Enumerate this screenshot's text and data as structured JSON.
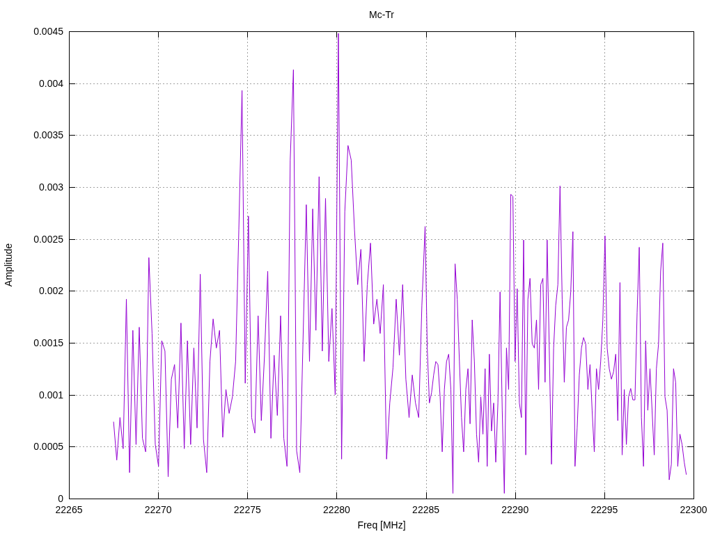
{
  "chart": {
    "chart_data": {
      "type": "line",
      "title": "Mc-Tr",
      "xlabel": "Freq [MHz]",
      "ylabel": "Amplitude",
      "xlim": [
        22265,
        22300
      ],
      "ylim": [
        0,
        0.0045
      ],
      "xticks": [
        22265,
        22270,
        22275,
        22280,
        22285,
        22290,
        22295,
        22300
      ],
      "yticks": [
        0,
        0.0005,
        0.001,
        0.0015,
        0.002,
        0.0025,
        0.003,
        0.0035,
        0.004,
        0.0045
      ],
      "x": [
        22267.5,
        22267.68,
        22267.86,
        22268.04,
        22268.22,
        22268.4,
        22268.58,
        22268.76,
        22268.94,
        22269.12,
        22269.3,
        22269.48,
        22269.66,
        22269.84,
        22270.02,
        22270.2,
        22270.38,
        22270.56,
        22270.74,
        22270.92,
        22271.1,
        22271.28,
        22271.46,
        22271.64,
        22271.82,
        22272.0,
        22272.18,
        22272.36,
        22272.54,
        22272.72,
        22272.9,
        22273.08,
        22273.26,
        22273.44,
        22273.62,
        22273.8,
        22273.98,
        22274.16,
        22274.34,
        22274.52,
        22274.7,
        22274.88,
        22275.06,
        22275.24,
        22275.42,
        22275.6,
        22275.78,
        22275.96,
        22276.14,
        22276.32,
        22276.5,
        22276.68,
        22276.86,
        22277.04,
        22277.22,
        22277.4,
        22277.58,
        22277.76,
        22277.94,
        22278.12,
        22278.3,
        22278.48,
        22278.66,
        22278.84,
        22279.02,
        22279.2,
        22279.38,
        22279.56,
        22279.74,
        22279.92,
        22280.1,
        22280.28,
        22280.46,
        22280.64,
        22280.82,
        22281.0,
        22281.18,
        22281.36,
        22281.54,
        22281.72,
        22281.9,
        22282.08,
        22282.26,
        22282.44,
        22282.62,
        22282.8,
        22282.98,
        22283.16,
        22283.34,
        22283.52,
        22283.7,
        22283.88,
        22284.06,
        22284.24,
        22284.42,
        22284.6,
        22284.78,
        22284.96,
        22285.08,
        22285.2,
        22285.32,
        22285.44,
        22285.56,
        22285.68,
        22285.8,
        22285.92,
        22286.04,
        22286.16,
        22286.28,
        22286.4,
        22286.52,
        22286.64,
        22286.76,
        22286.88,
        22287.0,
        22287.12,
        22287.24,
        22287.36,
        22287.48,
        22287.6,
        22287.72,
        22287.84,
        22287.96,
        22288.08,
        22288.2,
        22288.32,
        22288.44,
        22288.56,
        22288.68,
        22288.8,
        22288.92,
        22289.04,
        22289.16,
        22289.28,
        22289.4,
        22289.52,
        22289.64,
        22289.76,
        22289.88,
        22290.0,
        22290.12,
        22290.24,
        22290.36,
        22290.48,
        22290.6,
        22290.72,
        22290.84,
        22290.96,
        22291.08,
        22291.2,
        22291.32,
        22291.44,
        22291.56,
        22291.68,
        22291.8,
        22291.92,
        22292.04,
        22292.16,
        22292.28,
        22292.4,
        22292.52,
        22292.64,
        22292.76,
        22292.88,
        22293.0,
        22293.12,
        22293.24,
        22293.36,
        22293.48,
        22293.6,
        22293.72,
        22293.84,
        22293.96,
        22294.08,
        22294.2,
        22294.32,
        22294.44,
        22294.56,
        22294.68,
        22294.8,
        22294.92,
        22295.04,
        22295.16,
        22295.28,
        22295.4,
        22295.52,
        22295.64,
        22295.76,
        22295.88,
        22296.0,
        22296.12,
        22296.24,
        22296.36,
        22296.48,
        22296.6,
        22296.72,
        22296.84,
        22296.96,
        22297.08,
        22297.2,
        22297.32,
        22297.44,
        22297.56,
        22297.68,
        22297.8,
        22297.92,
        22298.04,
        22298.16,
        22298.28,
        22298.4,
        22298.52,
        22298.64,
        22298.76,
        22298.88,
        22299.0,
        22299.12,
        22299.24,
        22299.36,
        22299.48,
        22299.6
      ],
      "grid": true,
      "series": [
        {
          "color": "#9400d3",
          "values": [
            0.00074,
            0.00037,
            0.00078,
            0.00048,
            0.00192,
            0.00025,
            0.00162,
            0.00052,
            0.00165,
            0.00058,
            0.00045,
            0.00232,
            0.00159,
            0.00052,
            0.00031,
            0.00152,
            0.00142,
            0.00021,
            0.00115,
            0.00129,
            0.00068,
            0.00169,
            0.00048,
            0.00152,
            0.00052,
            0.00145,
            0.00068,
            0.00216,
            0.00057,
            0.00025,
            0.00132,
            0.00173,
            0.00145,
            0.00162,
            0.00059,
            0.00105,
            0.00082,
            0.00098,
            0.00132,
            0.00259,
            0.00393,
            0.00111,
            0.00272,
            0.00078,
            0.00063,
            0.00176,
            0.00075,
            0.00138,
            0.00219,
            0.00058,
            0.00138,
            0.0008,
            0.00176,
            0.00058,
            0.00031,
            0.00326,
            0.00413,
            0.00046,
            0.00025,
            0.00152,
            0.00283,
            0.00132,
            0.00279,
            0.00162,
            0.0031,
            0.00142,
            0.00289,
            0.00132,
            0.00183,
            0.001,
            0.00448,
            0.00038,
            0.00276,
            0.0034,
            0.00326,
            0.00259,
            0.00206,
            0.0024,
            0.00132,
            0.00206,
            0.00246,
            0.00168,
            0.00192,
            0.00159,
            0.00206,
            0.00038,
            0.00092,
            0.00126,
            0.00192,
            0.00138,
            0.00206,
            0.00115,
            0.00078,
            0.00119,
            0.00092,
            0.00078,
            0.00186,
            0.00262,
            0.00145,
            0.00092,
            0.00102,
            0.00119,
            0.00132,
            0.00129,
            0.00098,
            0.00045,
            0.00105,
            0.00132,
            0.00139,
            0.00105,
            5e-05,
            0.00226,
            0.00192,
            0.00132,
            0.00078,
            0.00045,
            0.00105,
            0.00125,
            0.00072,
            0.00172,
            0.00132,
            0.00062,
            0.00035,
            0.00098,
            0.00062,
            0.00125,
            0.00031,
            0.00139,
            0.00065,
            0.00092,
            0.00035,
            0.00092,
            0.00199,
            0.00085,
            5e-05,
            0.00145,
            0.00105,
            0.00293,
            0.00291,
            0.00132,
            0.00202,
            0.00092,
            0.00078,
            0.00249,
            0.00042,
            0.00192,
            0.00212,
            0.00149,
            0.00145,
            0.00172,
            0.00105,
            0.00206,
            0.00212,
            0.00112,
            0.00249,
            0.00142,
            0.00033,
            0.00145,
            0.00186,
            0.00206,
            0.00301,
            0.00192,
            0.00112,
            0.00165,
            0.00172,
            0.00199,
            0.00257,
            0.00031,
            0.00068,
            0.00119,
            0.00145,
            0.00155,
            0.00149,
            0.00105,
            0.00129,
            0.00085,
            0.00045,
            0.00125,
            0.00105,
            0.00132,
            0.00172,
            0.00253,
            0.00145,
            0.00125,
            0.00115,
            0.00122,
            0.00139,
            0.00075,
            0.00208,
            0.00042,
            0.00105,
            0.00052,
            0.00098,
            0.00106,
            0.00095,
            0.00095,
            0.00179,
            0.00242,
            0.00078,
            0.00031,
            0.00152,
            0.00085,
            0.00125,
            0.00085,
            0.00042,
            0.00125,
            0.00149,
            0.00219,
            0.00246,
            0.00098,
            0.00085,
            0.00018,
            0.00033,
            0.00125,
            0.00112,
            0.00031,
            0.00062,
            0.00052,
            0.00035,
            0.00023
          ]
        }
      ]
    }
  }
}
